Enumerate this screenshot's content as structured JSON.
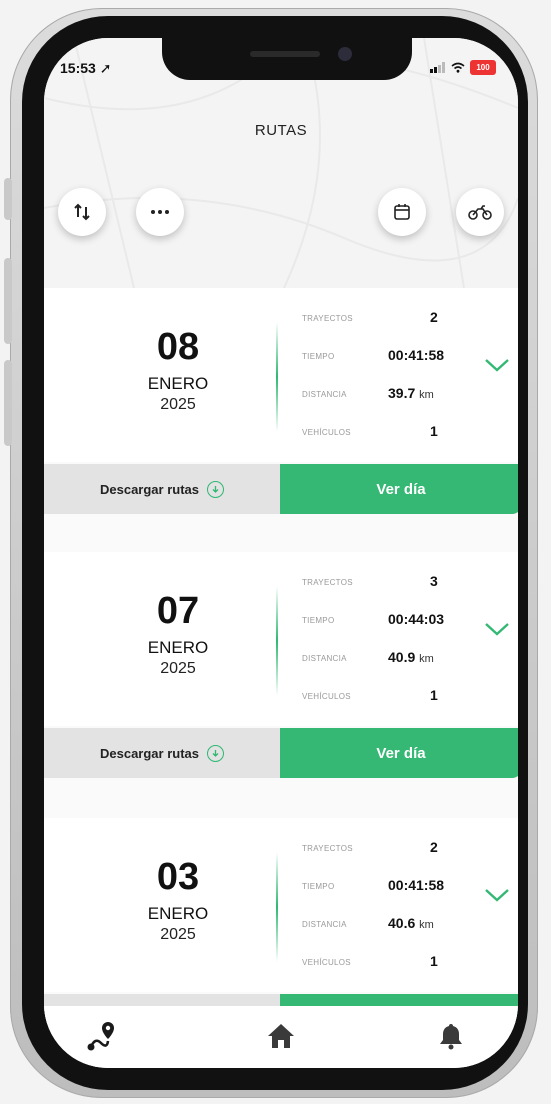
{
  "status": {
    "time": "15:53 ➚",
    "battery": "100"
  },
  "header": {
    "title": "RUTAS"
  },
  "toolbar": {
    "icons": [
      "swap-icon",
      "more-icon",
      "calendar-icon",
      "motorbike-icon"
    ]
  },
  "labels": {
    "trips": "TRAYECTOS",
    "time": "TIEMPO",
    "distance": "DISTANCIA",
    "vehicles": "VEHÍCULOS",
    "download": "Descargar rutas",
    "view_day": "Ver día"
  },
  "days": [
    {
      "day": "08",
      "month": "ENERO",
      "year": "2025",
      "trips": "2",
      "time": "00:41:58",
      "distance": "39.7",
      "unit": "km",
      "vehicles": "1"
    },
    {
      "day": "07",
      "month": "ENERO",
      "year": "2025",
      "trips": "3",
      "time": "00:44:03",
      "distance": "40.9",
      "unit": "km",
      "vehicles": "1"
    },
    {
      "day": "03",
      "month": "ENERO",
      "year": "2025",
      "trips": "2",
      "time": "00:41:58",
      "distance": "40.6",
      "unit": "km",
      "vehicles": "1"
    }
  ],
  "nav": {
    "items": [
      "routes-icon",
      "home-icon",
      "bell-icon"
    ],
    "active": "routes-icon"
  },
  "colors": {
    "accent": "#34b874",
    "download_bg": "#e3e3e3"
  }
}
